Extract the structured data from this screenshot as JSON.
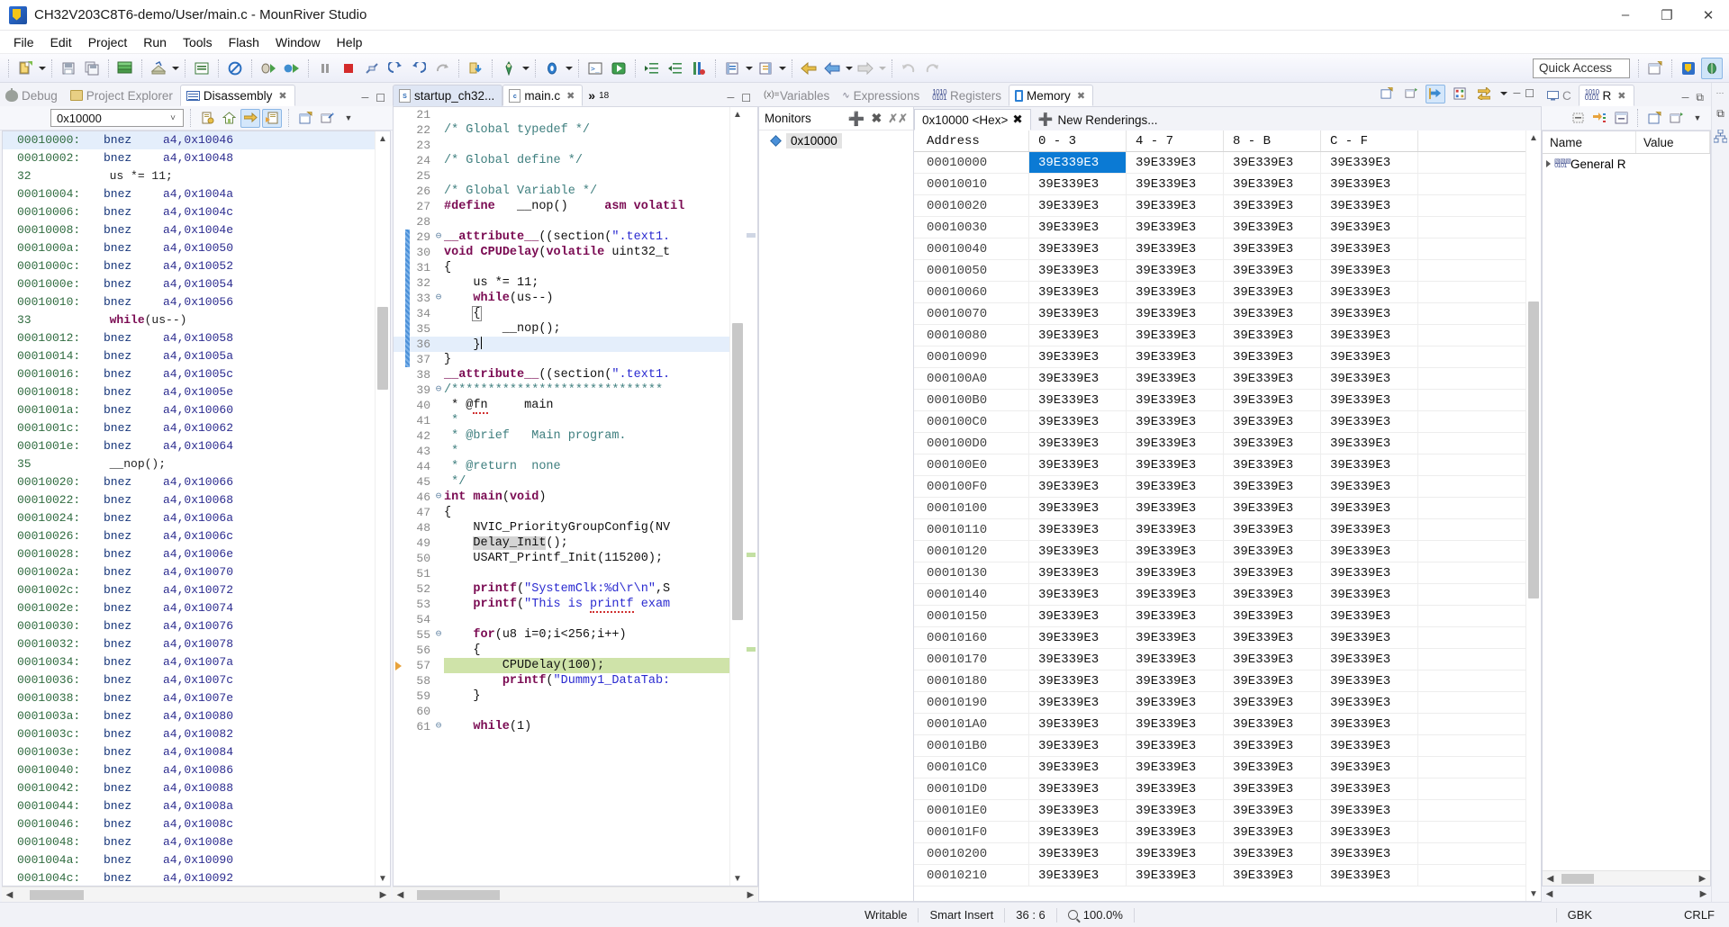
{
  "window": {
    "title": "CH32V203C8T6-demo/User/main.c - MounRiver Studio",
    "minimize": "–",
    "maximize": "❐",
    "close": "✕"
  },
  "menubar": [
    {
      "label": "File"
    },
    {
      "label": "Edit"
    },
    {
      "label": "Project"
    },
    {
      "label": "Run"
    },
    {
      "label": "Tools"
    },
    {
      "label": "Flash"
    },
    {
      "label": "Window"
    },
    {
      "label": "Help"
    }
  ],
  "toolbar": {
    "quick_access": "Quick Access"
  },
  "left_pane": {
    "tabs": [
      {
        "label": "Debug",
        "icon": "bug-icon",
        "active": false
      },
      {
        "label": "Project Explorer",
        "icon": "project-icon",
        "active": false
      },
      {
        "label": "Disassembly",
        "icon": "disassembly-icon",
        "active": true
      }
    ],
    "address_combo": "0x10000",
    "rows": [
      {
        "type": "asm",
        "addr": "00010000:",
        "mn": "bnez",
        "op": "a4,0x10046",
        "sel": true
      },
      {
        "type": "asm",
        "addr": "00010002:",
        "mn": "bnez",
        "op": "a4,0x10048"
      },
      {
        "type": "src",
        "no": "32",
        "text": "us *= 11;"
      },
      {
        "type": "asm",
        "addr": "00010004:",
        "mn": "bnez",
        "op": "a4,0x1004a"
      },
      {
        "type": "asm",
        "addr": "00010006:",
        "mn": "bnez",
        "op": "a4,0x1004c"
      },
      {
        "type": "asm",
        "addr": "00010008:",
        "mn": "bnez",
        "op": "a4,0x1004e"
      },
      {
        "type": "asm",
        "addr": "0001000a:",
        "mn": "bnez",
        "op": "a4,0x10050"
      },
      {
        "type": "asm",
        "addr": "0001000c:",
        "mn": "bnez",
        "op": "a4,0x10052"
      },
      {
        "type": "asm",
        "addr": "0001000e:",
        "mn": "bnez",
        "op": "a4,0x10054"
      },
      {
        "type": "asm",
        "addr": "00010010:",
        "mn": "bnez",
        "op": "a4,0x10056"
      },
      {
        "type": "src",
        "no": "33",
        "text": "while(us--)",
        "kw": "while"
      },
      {
        "type": "asm",
        "addr": "00010012:",
        "mn": "bnez",
        "op": "a4,0x10058"
      },
      {
        "type": "asm",
        "addr": "00010014:",
        "mn": "bnez",
        "op": "a4,0x1005a"
      },
      {
        "type": "asm",
        "addr": "00010016:",
        "mn": "bnez",
        "op": "a4,0x1005c"
      },
      {
        "type": "asm",
        "addr": "00010018:",
        "mn": "bnez",
        "op": "a4,0x1005e"
      },
      {
        "type": "asm",
        "addr": "0001001a:",
        "mn": "bnez",
        "op": "a4,0x10060"
      },
      {
        "type": "asm",
        "addr": "0001001c:",
        "mn": "bnez",
        "op": "a4,0x10062"
      },
      {
        "type": "asm",
        "addr": "0001001e:",
        "mn": "bnez",
        "op": "a4,0x10064"
      },
      {
        "type": "src",
        "no": "35",
        "text": "__nop();"
      },
      {
        "type": "asm",
        "addr": "00010020:",
        "mn": "bnez",
        "op": "a4,0x10066"
      },
      {
        "type": "asm",
        "addr": "00010022:",
        "mn": "bnez",
        "op": "a4,0x10068"
      },
      {
        "type": "asm",
        "addr": "00010024:",
        "mn": "bnez",
        "op": "a4,0x1006a"
      },
      {
        "type": "asm",
        "addr": "00010026:",
        "mn": "bnez",
        "op": "a4,0x1006c"
      },
      {
        "type": "asm",
        "addr": "00010028:",
        "mn": "bnez",
        "op": "a4,0x1006e"
      },
      {
        "type": "asm",
        "addr": "0001002a:",
        "mn": "bnez",
        "op": "a4,0x10070"
      },
      {
        "type": "asm",
        "addr": "0001002c:",
        "mn": "bnez",
        "op": "a4,0x10072"
      },
      {
        "type": "asm",
        "addr": "0001002e:",
        "mn": "bnez",
        "op": "a4,0x10074"
      },
      {
        "type": "asm",
        "addr": "00010030:",
        "mn": "bnez",
        "op": "a4,0x10076"
      },
      {
        "type": "asm",
        "addr": "00010032:",
        "mn": "bnez",
        "op": "a4,0x10078"
      },
      {
        "type": "asm",
        "addr": "00010034:",
        "mn": "bnez",
        "op": "a4,0x1007a"
      },
      {
        "type": "asm",
        "addr": "00010036:",
        "mn": "bnez",
        "op": "a4,0x1007c"
      },
      {
        "type": "asm",
        "addr": "00010038:",
        "mn": "bnez",
        "op": "a4,0x1007e"
      },
      {
        "type": "asm",
        "addr": "0001003a:",
        "mn": "bnez",
        "op": "a4,0x10080"
      },
      {
        "type": "asm",
        "addr": "0001003c:",
        "mn": "bnez",
        "op": "a4,0x10082"
      },
      {
        "type": "asm",
        "addr": "0001003e:",
        "mn": "bnez",
        "op": "a4,0x10084"
      },
      {
        "type": "asm",
        "addr": "00010040:",
        "mn": "bnez",
        "op": "a4,0x10086"
      },
      {
        "type": "asm",
        "addr": "00010042:",
        "mn": "bnez",
        "op": "a4,0x10088"
      },
      {
        "type": "asm",
        "addr": "00010044:",
        "mn": "bnez",
        "op": "a4,0x1008a"
      },
      {
        "type": "asm",
        "addr": "00010046:",
        "mn": "bnez",
        "op": "a4,0x1008c"
      },
      {
        "type": "asm",
        "addr": "00010048:",
        "mn": "bnez",
        "op": "a4,0x1008e"
      },
      {
        "type": "asm",
        "addr": "0001004a:",
        "mn": "bnez",
        "op": "a4,0x10090"
      },
      {
        "type": "asm",
        "addr": "0001004c:",
        "mn": "bnez",
        "op": "a4,0x10092"
      }
    ]
  },
  "editor": {
    "tabs": [
      {
        "label": "startup_ch32...",
        "icon": "asm-file-icon",
        "active": false
      },
      {
        "label": "main.c",
        "icon": "c-file-icon",
        "active": true
      }
    ],
    "overflow": "»",
    "overflow_count": "18",
    "lines": [
      {
        "no": "21",
        "text": ""
      },
      {
        "no": "22",
        "text": "/* Global typedef */",
        "cls": "c-comment"
      },
      {
        "no": "23",
        "text": ""
      },
      {
        "no": "24",
        "text": "/* Global define */",
        "cls": "c-comment"
      },
      {
        "no": "25",
        "text": ""
      },
      {
        "no": "26",
        "text": "/* Global Variable */",
        "cls": "c-comment"
      },
      {
        "no": "27",
        "text": "#define   __nop()     asm volatil",
        "html": "define"
      },
      {
        "no": "28",
        "text": ""
      },
      {
        "no": "29",
        "text": "__attribute__((section(\".text1.",
        "fold": "⊖",
        "chg": true,
        "html": "attr"
      },
      {
        "no": "30",
        "text": "void CPUDelay(volatile uint32_t",
        "chg": true,
        "html": "cpudelay"
      },
      {
        "no": "31",
        "text": "{",
        "chg": true
      },
      {
        "no": "32",
        "text": "    us *= 11;",
        "chg": true
      },
      {
        "no": "33",
        "text": "    while(us--)",
        "fold": "⊖",
        "chg": true,
        "html": "while"
      },
      {
        "no": "34",
        "text": "    {",
        "chg": true,
        "html": "brace-open"
      },
      {
        "no": "35",
        "text": "        __nop();",
        "chg": true
      },
      {
        "no": "36",
        "text": "    }",
        "chg": true,
        "hl": true,
        "caret": true
      },
      {
        "no": "37",
        "text": "}",
        "chg": true
      },
      {
        "no": "38",
        "text": "__attribute__((section(\".text1.",
        "html": "attr"
      },
      {
        "no": "39",
        "text": "/*****************************",
        "fold": "⊖",
        "cls": "c-comment"
      },
      {
        "no": "40",
        "text": " * @fn     main",
        "cls": "c-comment",
        "html": "fn"
      },
      {
        "no": "41",
        "text": " *",
        "cls": "c-comment"
      },
      {
        "no": "42",
        "text": " * @brief   Main program.",
        "cls": "c-comment"
      },
      {
        "no": "43",
        "text": " *",
        "cls": "c-comment"
      },
      {
        "no": "44",
        "text": " * @return  none",
        "cls": "c-comment"
      },
      {
        "no": "45",
        "text": " */",
        "cls": "c-comment"
      },
      {
        "no": "46",
        "text": "int main(void)",
        "fold": "⊖",
        "html": "main"
      },
      {
        "no": "47",
        "text": "{"
      },
      {
        "no": "48",
        "text": "    NVIC_PriorityGroupConfig(NV"
      },
      {
        "no": "49",
        "text": "    Delay_Init();",
        "html": "delayinit"
      },
      {
        "no": "50",
        "text": "    USART_Printf_Init(115200);"
      },
      {
        "no": "51",
        "text": ""
      },
      {
        "no": "52",
        "text": "    printf(\"SystemClk:%d\\r\\n\",S",
        "html": "printf1"
      },
      {
        "no": "53",
        "text": "    printf(\"This is printf exam",
        "html": "printf2"
      },
      {
        "no": "54",
        "text": ""
      },
      {
        "no": "55",
        "text": "    for(u8 i=0;i<256;i++)",
        "fold": "⊖",
        "html": "for"
      },
      {
        "no": "56",
        "text": "    {"
      },
      {
        "no": "57",
        "text": "        CPUDelay(100);",
        "exec": true
      },
      {
        "no": "58",
        "text": "        printf(\"Dummy1_DataTab:",
        "html": "printf3"
      },
      {
        "no": "59",
        "text": "    }"
      },
      {
        "no": "60",
        "text": ""
      },
      {
        "no": "61",
        "text": "    while(1)",
        "fold": "⊖",
        "html": "while1"
      }
    ]
  },
  "memory": {
    "view_tabs": [
      {
        "label": "Variables",
        "icon": "variables-icon",
        "active": false
      },
      {
        "label": "Expressions",
        "icon": "expressions-icon",
        "active": false
      },
      {
        "label": "Registers",
        "icon": "registers-icon",
        "active": false
      },
      {
        "label": "Memory",
        "icon": "memory-icon",
        "active": true
      }
    ],
    "monitors_label": "Monitors",
    "monitor_items": [
      "0x10000"
    ],
    "rendering_tabs": [
      {
        "label": "0x10000 <Hex>",
        "closable": true
      },
      {
        "label": "New Renderings...",
        "closable": false
      }
    ],
    "columns": [
      "Address",
      "0 - 3",
      "4 - 7",
      "8 - B",
      "C - F"
    ],
    "rows": [
      {
        "addr": "00010000",
        "vals": [
          "39E339E3",
          "39E339E3",
          "39E339E3",
          "39E339E3"
        ],
        "sel": 0
      },
      {
        "addr": "00010010",
        "vals": [
          "39E339E3",
          "39E339E3",
          "39E339E3",
          "39E339E3"
        ]
      },
      {
        "addr": "00010020",
        "vals": [
          "39E339E3",
          "39E339E3",
          "39E339E3",
          "39E339E3"
        ]
      },
      {
        "addr": "00010030",
        "vals": [
          "39E339E3",
          "39E339E3",
          "39E339E3",
          "39E339E3"
        ]
      },
      {
        "addr": "00010040",
        "vals": [
          "39E339E3",
          "39E339E3",
          "39E339E3",
          "39E339E3"
        ]
      },
      {
        "addr": "00010050",
        "vals": [
          "39E339E3",
          "39E339E3",
          "39E339E3",
          "39E339E3"
        ]
      },
      {
        "addr": "00010060",
        "vals": [
          "39E339E3",
          "39E339E3",
          "39E339E3",
          "39E339E3"
        ]
      },
      {
        "addr": "00010070",
        "vals": [
          "39E339E3",
          "39E339E3",
          "39E339E3",
          "39E339E3"
        ]
      },
      {
        "addr": "00010080",
        "vals": [
          "39E339E3",
          "39E339E3",
          "39E339E3",
          "39E339E3"
        ]
      },
      {
        "addr": "00010090",
        "vals": [
          "39E339E3",
          "39E339E3",
          "39E339E3",
          "39E339E3"
        ]
      },
      {
        "addr": "000100A0",
        "vals": [
          "39E339E3",
          "39E339E3",
          "39E339E3",
          "39E339E3"
        ]
      },
      {
        "addr": "000100B0",
        "vals": [
          "39E339E3",
          "39E339E3",
          "39E339E3",
          "39E339E3"
        ]
      },
      {
        "addr": "000100C0",
        "vals": [
          "39E339E3",
          "39E339E3",
          "39E339E3",
          "39E339E3"
        ]
      },
      {
        "addr": "000100D0",
        "vals": [
          "39E339E3",
          "39E339E3",
          "39E339E3",
          "39E339E3"
        ]
      },
      {
        "addr": "000100E0",
        "vals": [
          "39E339E3",
          "39E339E3",
          "39E339E3",
          "39E339E3"
        ]
      },
      {
        "addr": "000100F0",
        "vals": [
          "39E339E3",
          "39E339E3",
          "39E339E3",
          "39E339E3"
        ]
      },
      {
        "addr": "00010100",
        "vals": [
          "39E339E3",
          "39E339E3",
          "39E339E3",
          "39E339E3"
        ]
      },
      {
        "addr": "00010110",
        "vals": [
          "39E339E3",
          "39E339E3",
          "39E339E3",
          "39E339E3"
        ]
      },
      {
        "addr": "00010120",
        "vals": [
          "39E339E3",
          "39E339E3",
          "39E339E3",
          "39E339E3"
        ]
      },
      {
        "addr": "00010130",
        "vals": [
          "39E339E3",
          "39E339E3",
          "39E339E3",
          "39E339E3"
        ]
      },
      {
        "addr": "00010140",
        "vals": [
          "39E339E3",
          "39E339E3",
          "39E339E3",
          "39E339E3"
        ]
      },
      {
        "addr": "00010150",
        "vals": [
          "39E339E3",
          "39E339E3",
          "39E339E3",
          "39E339E3"
        ]
      },
      {
        "addr": "00010160",
        "vals": [
          "39E339E3",
          "39E339E3",
          "39E339E3",
          "39E339E3"
        ]
      },
      {
        "addr": "00010170",
        "vals": [
          "39E339E3",
          "39E339E3",
          "39E339E3",
          "39E339E3"
        ]
      },
      {
        "addr": "00010180",
        "vals": [
          "39E339E3",
          "39E339E3",
          "39E339E3",
          "39E339E3"
        ]
      },
      {
        "addr": "00010190",
        "vals": [
          "39E339E3",
          "39E339E3",
          "39E339E3",
          "39E339E3"
        ]
      },
      {
        "addr": "000101A0",
        "vals": [
          "39E339E3",
          "39E339E3",
          "39E339E3",
          "39E339E3"
        ]
      },
      {
        "addr": "000101B0",
        "vals": [
          "39E339E3",
          "39E339E3",
          "39E339E3",
          "39E339E3"
        ]
      },
      {
        "addr": "000101C0",
        "vals": [
          "39E339E3",
          "39E339E3",
          "39E339E3",
          "39E339E3"
        ]
      },
      {
        "addr": "000101D0",
        "vals": [
          "39E339E3",
          "39E339E3",
          "39E339E3",
          "39E339E3"
        ]
      },
      {
        "addr": "000101E0",
        "vals": [
          "39E339E3",
          "39E339E3",
          "39E339E3",
          "39E339E3"
        ]
      },
      {
        "addr": "000101F0",
        "vals": [
          "39E339E3",
          "39E339E3",
          "39E339E3",
          "39E339E3"
        ]
      },
      {
        "addr": "00010200",
        "vals": [
          "39E339E3",
          "39E339E3",
          "39E339E3",
          "39E339E3"
        ]
      },
      {
        "addr": "00010210",
        "vals": [
          "39E339E3",
          "39E339E3",
          "39E339E3",
          "39E339E3"
        ]
      }
    ]
  },
  "registers_pane": {
    "tabs": [
      {
        "label": "C",
        "icon": "console-icon",
        "active": false
      },
      {
        "label": "R",
        "icon": "registers-icon",
        "active": true
      }
    ],
    "columns": [
      "Name",
      "Value"
    ],
    "rows": [
      {
        "name": "General R",
        "value": ""
      }
    ]
  },
  "statusbar": {
    "writable": "Writable",
    "insert_mode": "Smart Insert",
    "position": "36 : 6",
    "zoom": "100.0%",
    "encoding": "GBK",
    "line_ending": "CRLF"
  }
}
